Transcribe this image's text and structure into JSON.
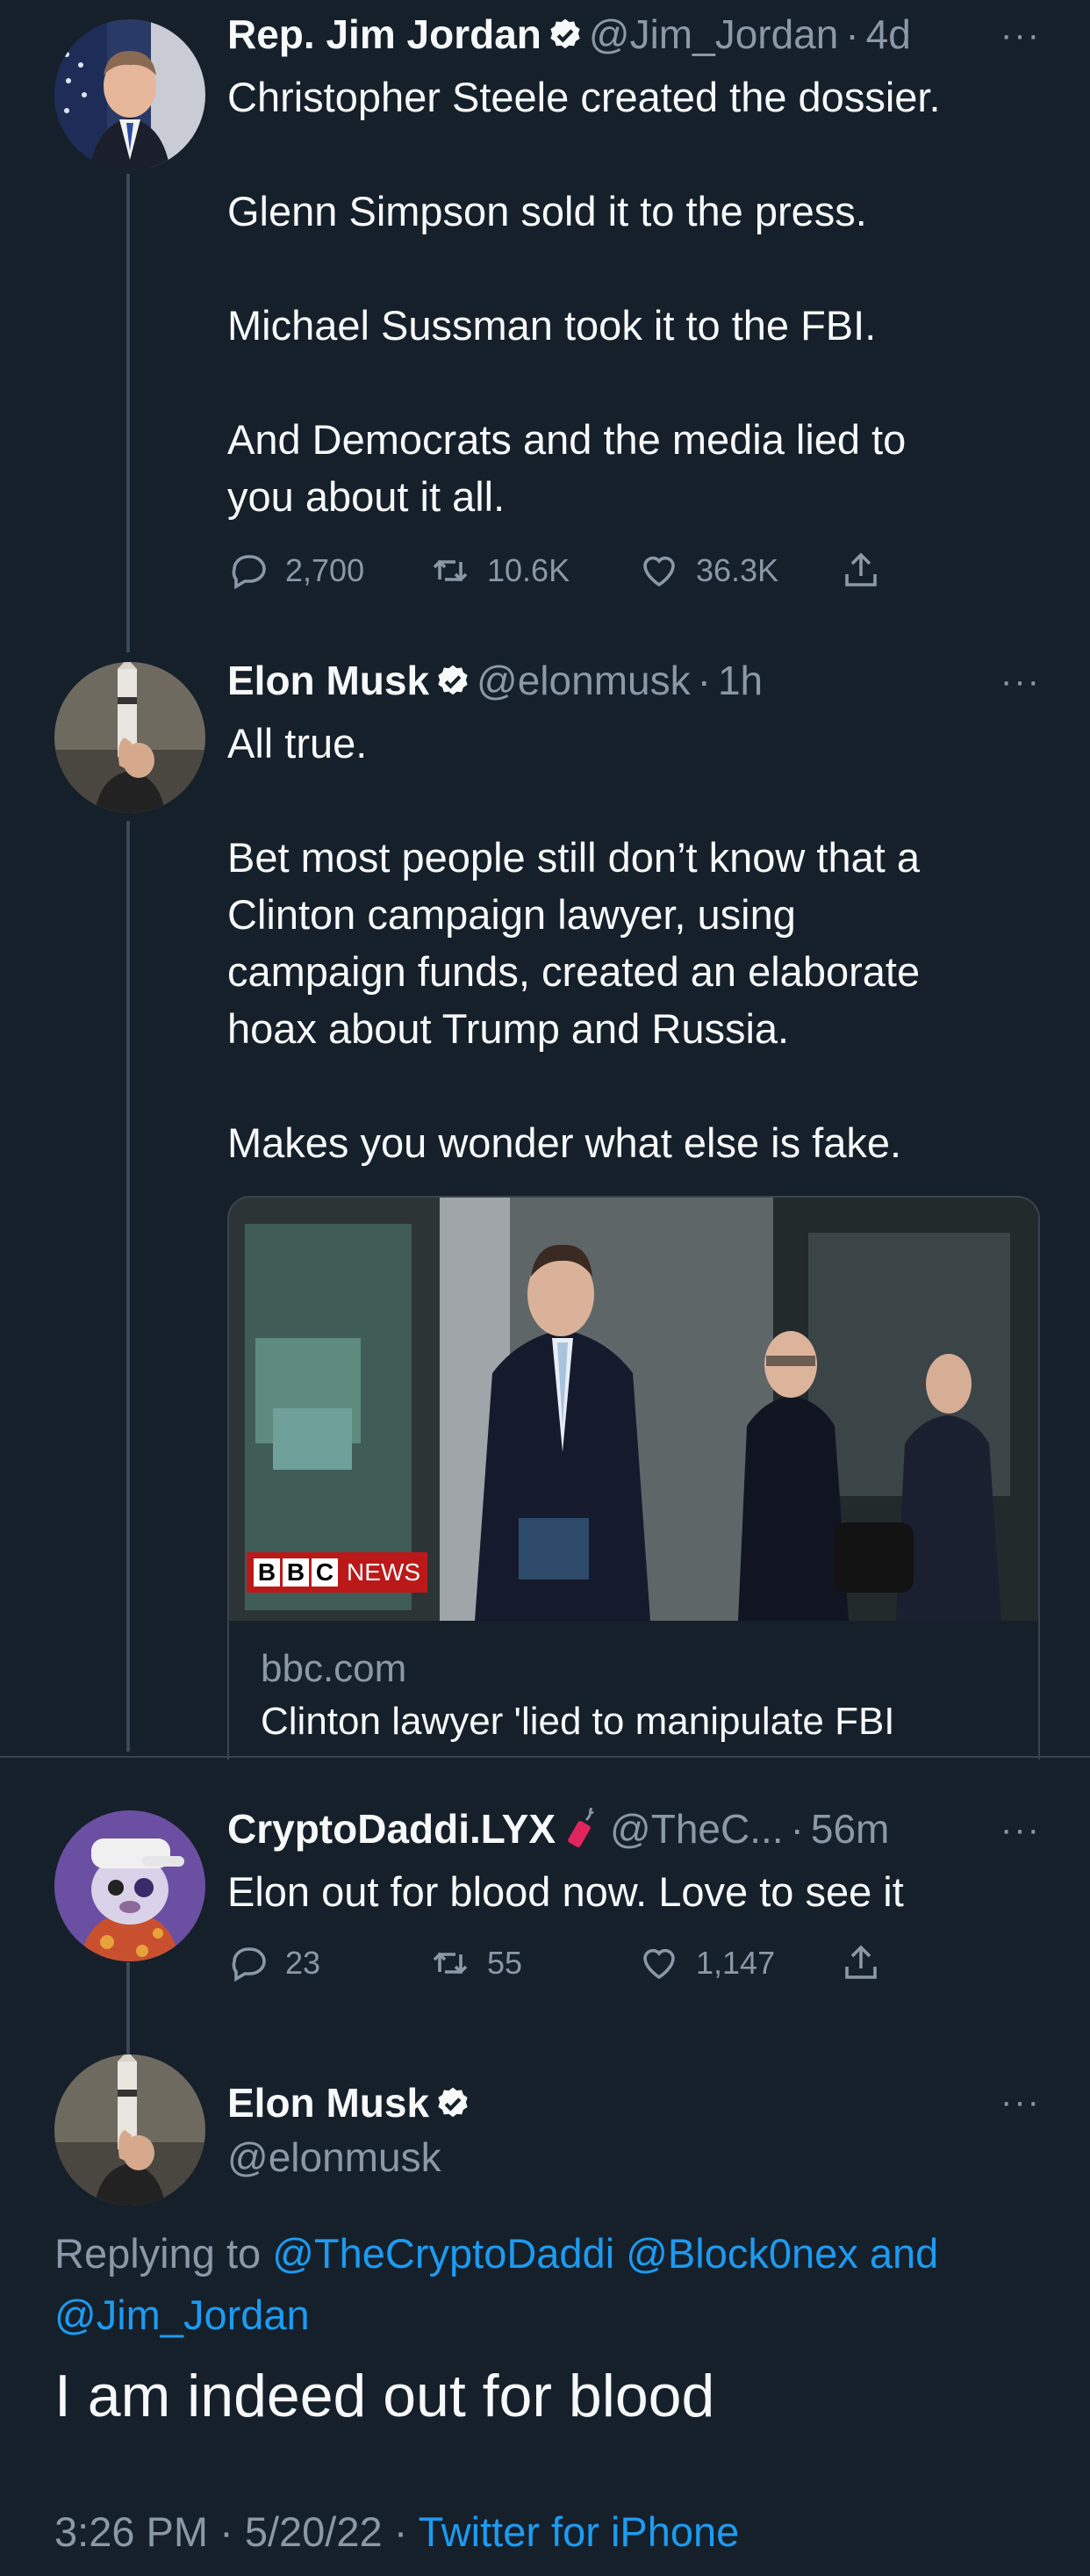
{
  "tweet1": {
    "name": "Rep. Jim Jordan",
    "handle": "@Jim_Jordan",
    "sep": "·",
    "time": "4d",
    "lines": [
      "Christopher Steele created the dossier.",
      "",
      "Glenn Simpson sold it to the press.",
      "",
      "Michael Sussman took it to the FBI.",
      "",
      "And Democrats and the media lied to",
      "you about it all."
    ],
    "replies": "2,700",
    "retweets": "10.6K",
    "likes": "36.3K"
  },
  "tweet2": {
    "name": "Elon Musk",
    "handle": "@elonmusk",
    "sep": "·",
    "time": "1h",
    "lines": [
      "All true.",
      "",
      "Bet most people still don’t know that a",
      "Clinton campaign lawyer, using",
      "campaign funds, created an elaborate",
      "hoax about Trump and Russia.",
      "",
      "Makes you wonder what else is fake."
    ],
    "card": {
      "domain": "bbc.com",
      "title": "Clinton lawyer 'lied to manipulate FBI",
      "bbc_letters": [
        "B",
        "B",
        "C"
      ],
      "news_label": "NEWS"
    }
  },
  "tweet3": {
    "name": "CryptoDaddi.LYX",
    "handle": "@TheC...",
    "sep": "·",
    "time": "56m",
    "text": "Elon out for blood now. Love to see it",
    "replies": "23",
    "retweets": "55",
    "likes": "1,147"
  },
  "main": {
    "name": "Elon Musk",
    "handle": "@elonmusk",
    "replying_prefix": "Replying to",
    "mentions": [
      "@TheCryptoDaddi",
      "@Block0nex",
      "@Jim_Jordan"
    ],
    "and_word": "and",
    "text": "I am indeed out for blood",
    "time": "3:26 PM",
    "date": "5/20/22",
    "source": "Twitter for iPhone",
    "sep": "·"
  },
  "more_label": "···",
  "colors": {
    "background": "#15202b",
    "secondary": "#8b98a5",
    "accent": "#1d9bf0",
    "verified": "#f7f9f9",
    "firecracker": "#e0245e"
  },
  "icons": [
    "reply-icon",
    "retweet-icon",
    "like-icon",
    "share-icon",
    "verified-icon",
    "more-icon",
    "firecracker-icon"
  ]
}
